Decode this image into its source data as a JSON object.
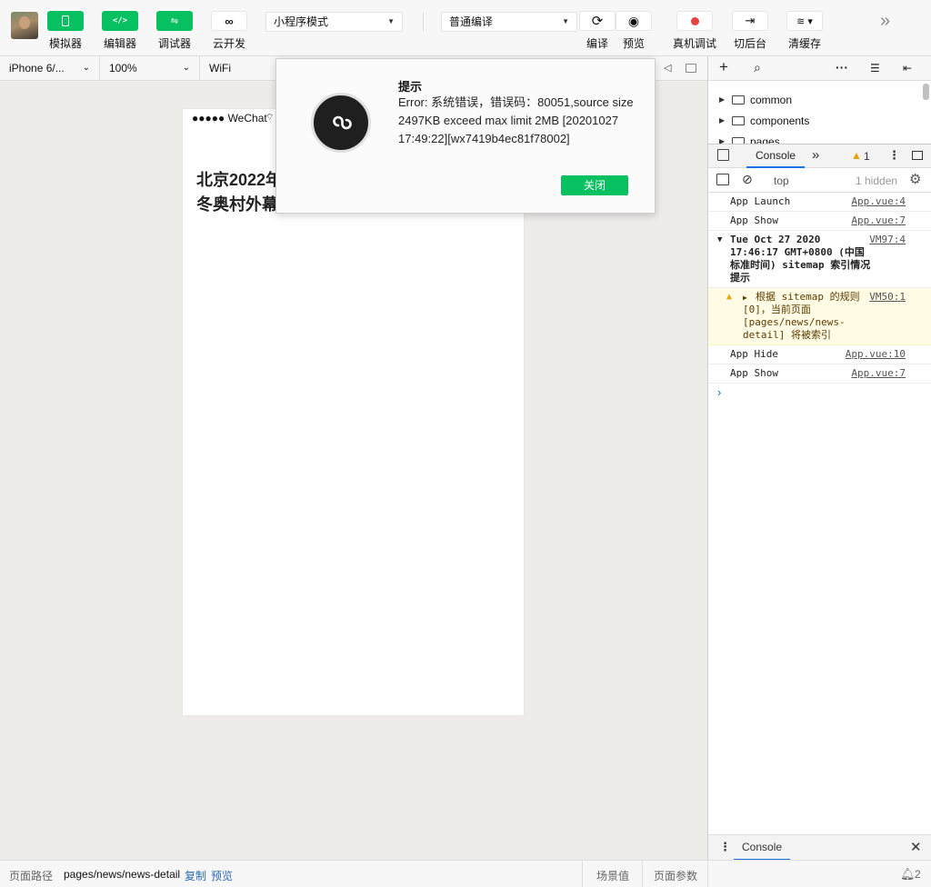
{
  "toolbar": {
    "simulator": "模拟器",
    "editor": "编辑器",
    "debugger": "调试器",
    "cloud": "云开发",
    "mode_select": "小程序模式",
    "compile_select": "普通编译",
    "compile": "编译",
    "preview": "预览",
    "real_debug": "真机调试",
    "background": "切后台",
    "clear_cache": "清缓存",
    "more": "»"
  },
  "subbar": {
    "device": "iPhone 6/...",
    "zoom": "100%",
    "network": "WiFi"
  },
  "phone": {
    "status": "●●●●● WeChat",
    "headline": "北京2022年\n冬奥村外幕"
  },
  "dialog": {
    "title": "提示",
    "message": "Error: 系统错误，错误码：80051,source size 2497KB exceed max limit 2MB [20201027 17:49:22][wx7419b4ec81f78002]",
    "close": "关闭"
  },
  "tree": {
    "items": [
      "common",
      "components",
      "pages"
    ]
  },
  "devtools": {
    "tab": "Console",
    "warn_count": "1",
    "context": "top",
    "hidden": "1 hidden",
    "logs": [
      {
        "text": "App Launch",
        "src": "App.vue:4"
      },
      {
        "text": "App Show",
        "src": "App.vue:7"
      },
      {
        "text": "Tue Oct 27 2020 17:46:17 GMT+0800 (中国标准时间) sitemap 索引情况提示",
        "src": "VM97:4"
      },
      {
        "text": "根据 sitemap 的规则[0]，当前页面 [pages/news/news-detail] 将被索引",
        "src": "VM50:1"
      },
      {
        "text": "App Hide",
        "src": "App.vue:10"
      },
      {
        "text": "App Show",
        "src": "App.vue:7"
      }
    ],
    "drawer_tab": "Console"
  },
  "bottombar": {
    "path_label": "页面路径",
    "path": "pages/news/news-detail",
    "copy": "复制",
    "preview": "预览",
    "scene": "场景值",
    "params": "页面参数",
    "notif_count": "2"
  },
  "colors": {
    "brand": "#07c160",
    "link": "#2d6bb5"
  }
}
